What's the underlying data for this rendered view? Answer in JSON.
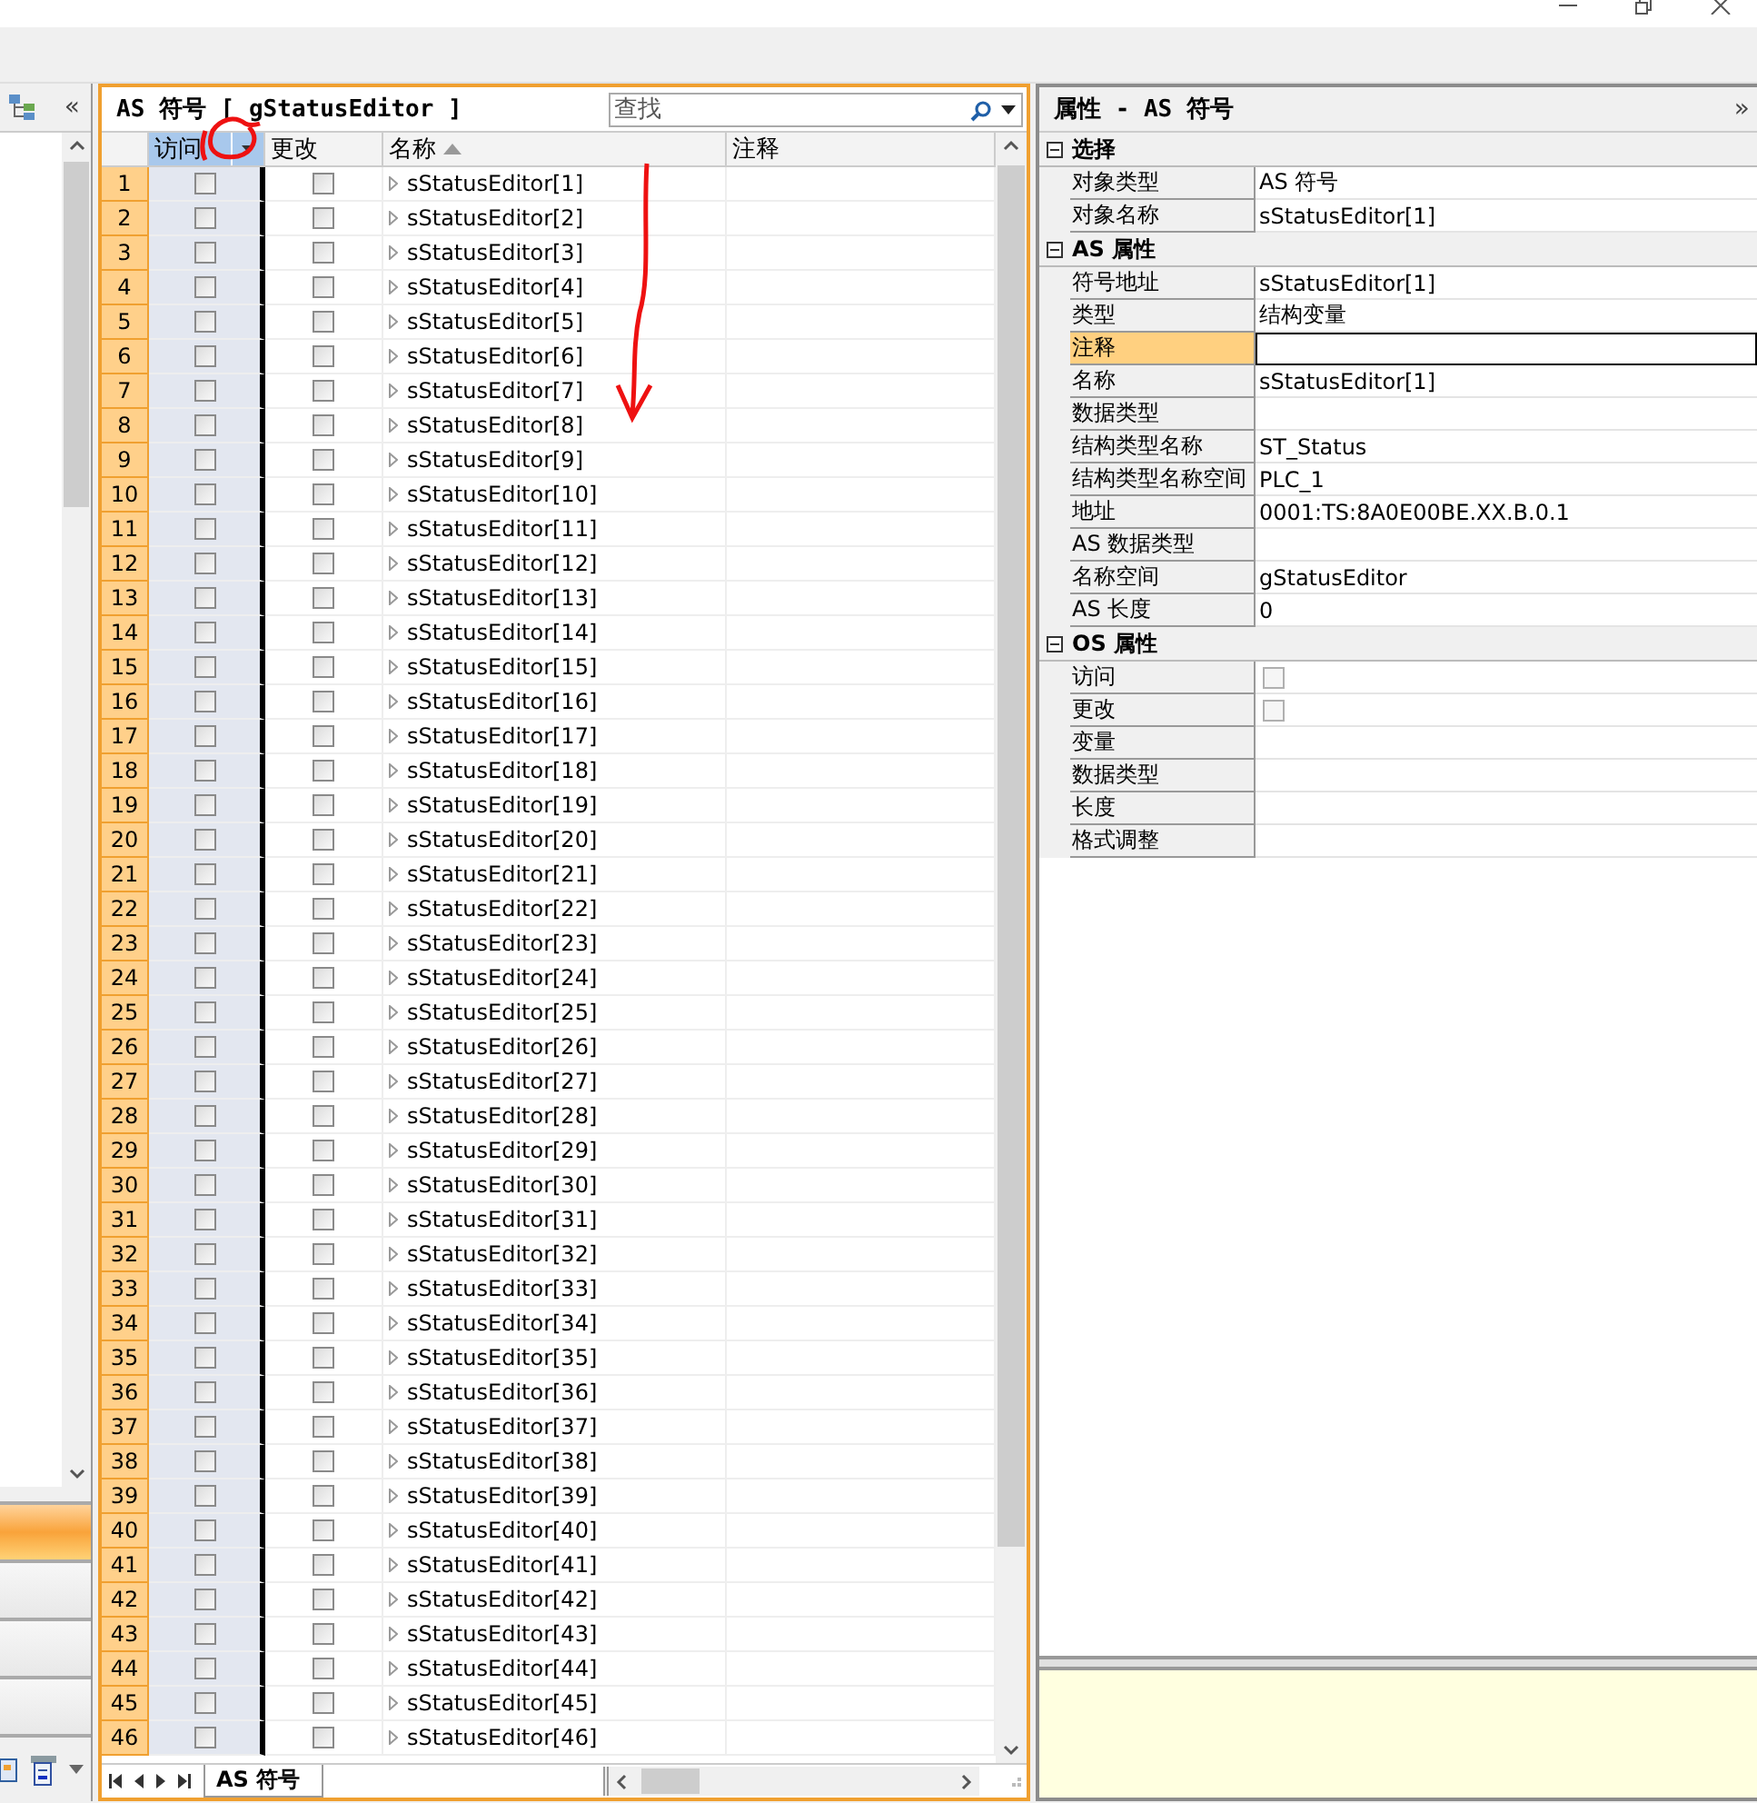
{
  "left_panel": {
    "collapse_button": "«"
  },
  "symbol_table": {
    "title": "AS 符号 [ gStatusEditor ]",
    "search": {
      "placeholder": "查找"
    },
    "columns": [
      {
        "label": "访问",
        "kind": "check",
        "selected": true,
        "filter": true,
        "sorted": false
      },
      {
        "label": "更改",
        "kind": "check",
        "selected": false,
        "filter": false,
        "sorted": false
      },
      {
        "label": "名称",
        "kind": "name",
        "selected": false,
        "filter": false,
        "sorted": true
      },
      {
        "label": "注释",
        "kind": "text",
        "selected": false,
        "filter": false,
        "sorted": false
      }
    ],
    "rows": [
      {
        "number": "1",
        "access": false,
        "change": false,
        "name": "sStatusEditor[1]"
      },
      {
        "number": "2",
        "access": false,
        "change": false,
        "name": "sStatusEditor[2]"
      },
      {
        "number": "3",
        "access": false,
        "change": false,
        "name": "sStatusEditor[3]"
      },
      {
        "number": "4",
        "access": false,
        "change": false,
        "name": "sStatusEditor[4]"
      },
      {
        "number": "5",
        "access": false,
        "change": false,
        "name": "sStatusEditor[5]"
      },
      {
        "number": "6",
        "access": false,
        "change": false,
        "name": "sStatusEditor[6]"
      },
      {
        "number": "7",
        "access": false,
        "change": false,
        "name": "sStatusEditor[7]"
      },
      {
        "number": "8",
        "access": false,
        "change": false,
        "name": "sStatusEditor[8]"
      },
      {
        "number": "9",
        "access": false,
        "change": false,
        "name": "sStatusEditor[9]"
      },
      {
        "number": "10",
        "access": false,
        "change": false,
        "name": "sStatusEditor[10]"
      },
      {
        "number": "11",
        "access": false,
        "change": false,
        "name": "sStatusEditor[11]"
      },
      {
        "number": "12",
        "access": false,
        "change": false,
        "name": "sStatusEditor[12]"
      },
      {
        "number": "13",
        "access": false,
        "change": false,
        "name": "sStatusEditor[13]"
      },
      {
        "number": "14",
        "access": false,
        "change": false,
        "name": "sStatusEditor[14]"
      },
      {
        "number": "15",
        "access": false,
        "change": false,
        "name": "sStatusEditor[15]"
      },
      {
        "number": "16",
        "access": false,
        "change": false,
        "name": "sStatusEditor[16]"
      },
      {
        "number": "17",
        "access": false,
        "change": false,
        "name": "sStatusEditor[17]"
      },
      {
        "number": "18",
        "access": false,
        "change": false,
        "name": "sStatusEditor[18]"
      },
      {
        "number": "19",
        "access": false,
        "change": false,
        "name": "sStatusEditor[19]"
      },
      {
        "number": "20",
        "access": false,
        "change": false,
        "name": "sStatusEditor[20]"
      },
      {
        "number": "21",
        "access": false,
        "change": false,
        "name": "sStatusEditor[21]"
      },
      {
        "number": "22",
        "access": false,
        "change": false,
        "name": "sStatusEditor[22]"
      },
      {
        "number": "23",
        "access": false,
        "change": false,
        "name": "sStatusEditor[23]"
      },
      {
        "number": "24",
        "access": false,
        "change": false,
        "name": "sStatusEditor[24]"
      },
      {
        "number": "25",
        "access": false,
        "change": false,
        "name": "sStatusEditor[25]"
      },
      {
        "number": "26",
        "access": false,
        "change": false,
        "name": "sStatusEditor[26]"
      },
      {
        "number": "27",
        "access": false,
        "change": false,
        "name": "sStatusEditor[27]"
      },
      {
        "number": "28",
        "access": false,
        "change": false,
        "name": "sStatusEditor[28]"
      },
      {
        "number": "29",
        "access": false,
        "change": false,
        "name": "sStatusEditor[29]"
      },
      {
        "number": "30",
        "access": false,
        "change": false,
        "name": "sStatusEditor[30]"
      },
      {
        "number": "31",
        "access": false,
        "change": false,
        "name": "sStatusEditor[31]"
      },
      {
        "number": "32",
        "access": false,
        "change": false,
        "name": "sStatusEditor[32]"
      },
      {
        "number": "33",
        "access": false,
        "change": false,
        "name": "sStatusEditor[33]"
      },
      {
        "number": "34",
        "access": false,
        "change": false,
        "name": "sStatusEditor[34]"
      },
      {
        "number": "35",
        "access": false,
        "change": false,
        "name": "sStatusEditor[35]"
      },
      {
        "number": "36",
        "access": false,
        "change": false,
        "name": "sStatusEditor[36]"
      },
      {
        "number": "37",
        "access": false,
        "change": false,
        "name": "sStatusEditor[37]"
      },
      {
        "number": "38",
        "access": false,
        "change": false,
        "name": "sStatusEditor[38]"
      },
      {
        "number": "39",
        "access": false,
        "change": false,
        "name": "sStatusEditor[39]"
      },
      {
        "number": "40",
        "access": false,
        "change": false,
        "name": "sStatusEditor[40]"
      },
      {
        "number": "41",
        "access": false,
        "change": false,
        "name": "sStatusEditor[41]"
      },
      {
        "number": "42",
        "access": false,
        "change": false,
        "name": "sStatusEditor[42]"
      },
      {
        "number": "43",
        "access": false,
        "change": false,
        "name": "sStatusEditor[43]"
      },
      {
        "number": "44",
        "access": false,
        "change": false,
        "name": "sStatusEditor[44]"
      },
      {
        "number": "45",
        "access": false,
        "change": false,
        "name": "sStatusEditor[45]"
      },
      {
        "number": "46",
        "access": false,
        "change": false,
        "name": "sStatusEditor[46]"
      }
    ],
    "sheet_tab": "AS 符号"
  },
  "properties": {
    "title": "属性 - AS 符号",
    "collapse_button": "»",
    "sections": [
      {
        "title": "选择",
        "expanded": true,
        "rows": [
          {
            "label": "对象类型",
            "kind": "text",
            "value": "AS 符号",
            "selected": false
          },
          {
            "label": "对象名称",
            "kind": "text",
            "value": "sStatusEditor[1]",
            "selected": false
          }
        ]
      },
      {
        "title": "AS 属性",
        "expanded": true,
        "rows": [
          {
            "label": "符号地址",
            "kind": "text",
            "value": "sStatusEditor[1]",
            "selected": false
          },
          {
            "label": "类型",
            "kind": "text",
            "value": "结构变量",
            "selected": false
          },
          {
            "label": "注释",
            "kind": "text",
            "selected": true
          },
          {
            "label": "名称",
            "kind": "text",
            "value": "sStatusEditor[1]",
            "selected": false
          },
          {
            "label": "数据类型",
            "kind": "text",
            "selected": false
          },
          {
            "label": "结构类型名称",
            "kind": "text",
            "value": "ST_Status",
            "selected": false
          },
          {
            "label": "结构类型名称空间",
            "kind": "text",
            "value": "PLC_1",
            "selected": false
          },
          {
            "label": "地址",
            "kind": "text",
            "value": "0001:TS:8A0E00BE.XX.B.0.1",
            "selected": false
          },
          {
            "label": "AS 数据类型",
            "kind": "text",
            "selected": false
          },
          {
            "label": "名称空间",
            "kind": "text",
            "value": "gStatusEditor",
            "selected": false
          },
          {
            "label": "AS 长度",
            "kind": "text",
            "value": "0",
            "selected": false
          }
        ]
      },
      {
        "title": "OS 属性",
        "expanded": true,
        "rows": [
          {
            "label": "访问",
            "kind": "checkbox",
            "checked": false,
            "selected": false
          },
          {
            "label": "更改",
            "kind": "checkbox",
            "checked": false,
            "selected": false
          },
          {
            "label": "变量",
            "kind": "text",
            "selected": false
          },
          {
            "label": "数据类型",
            "kind": "text",
            "selected": false
          },
          {
            "label": "长度",
            "kind": "text",
            "selected": false
          },
          {
            "label": "格式调整",
            "kind": "text",
            "selected": false
          }
        ]
      }
    ]
  }
}
